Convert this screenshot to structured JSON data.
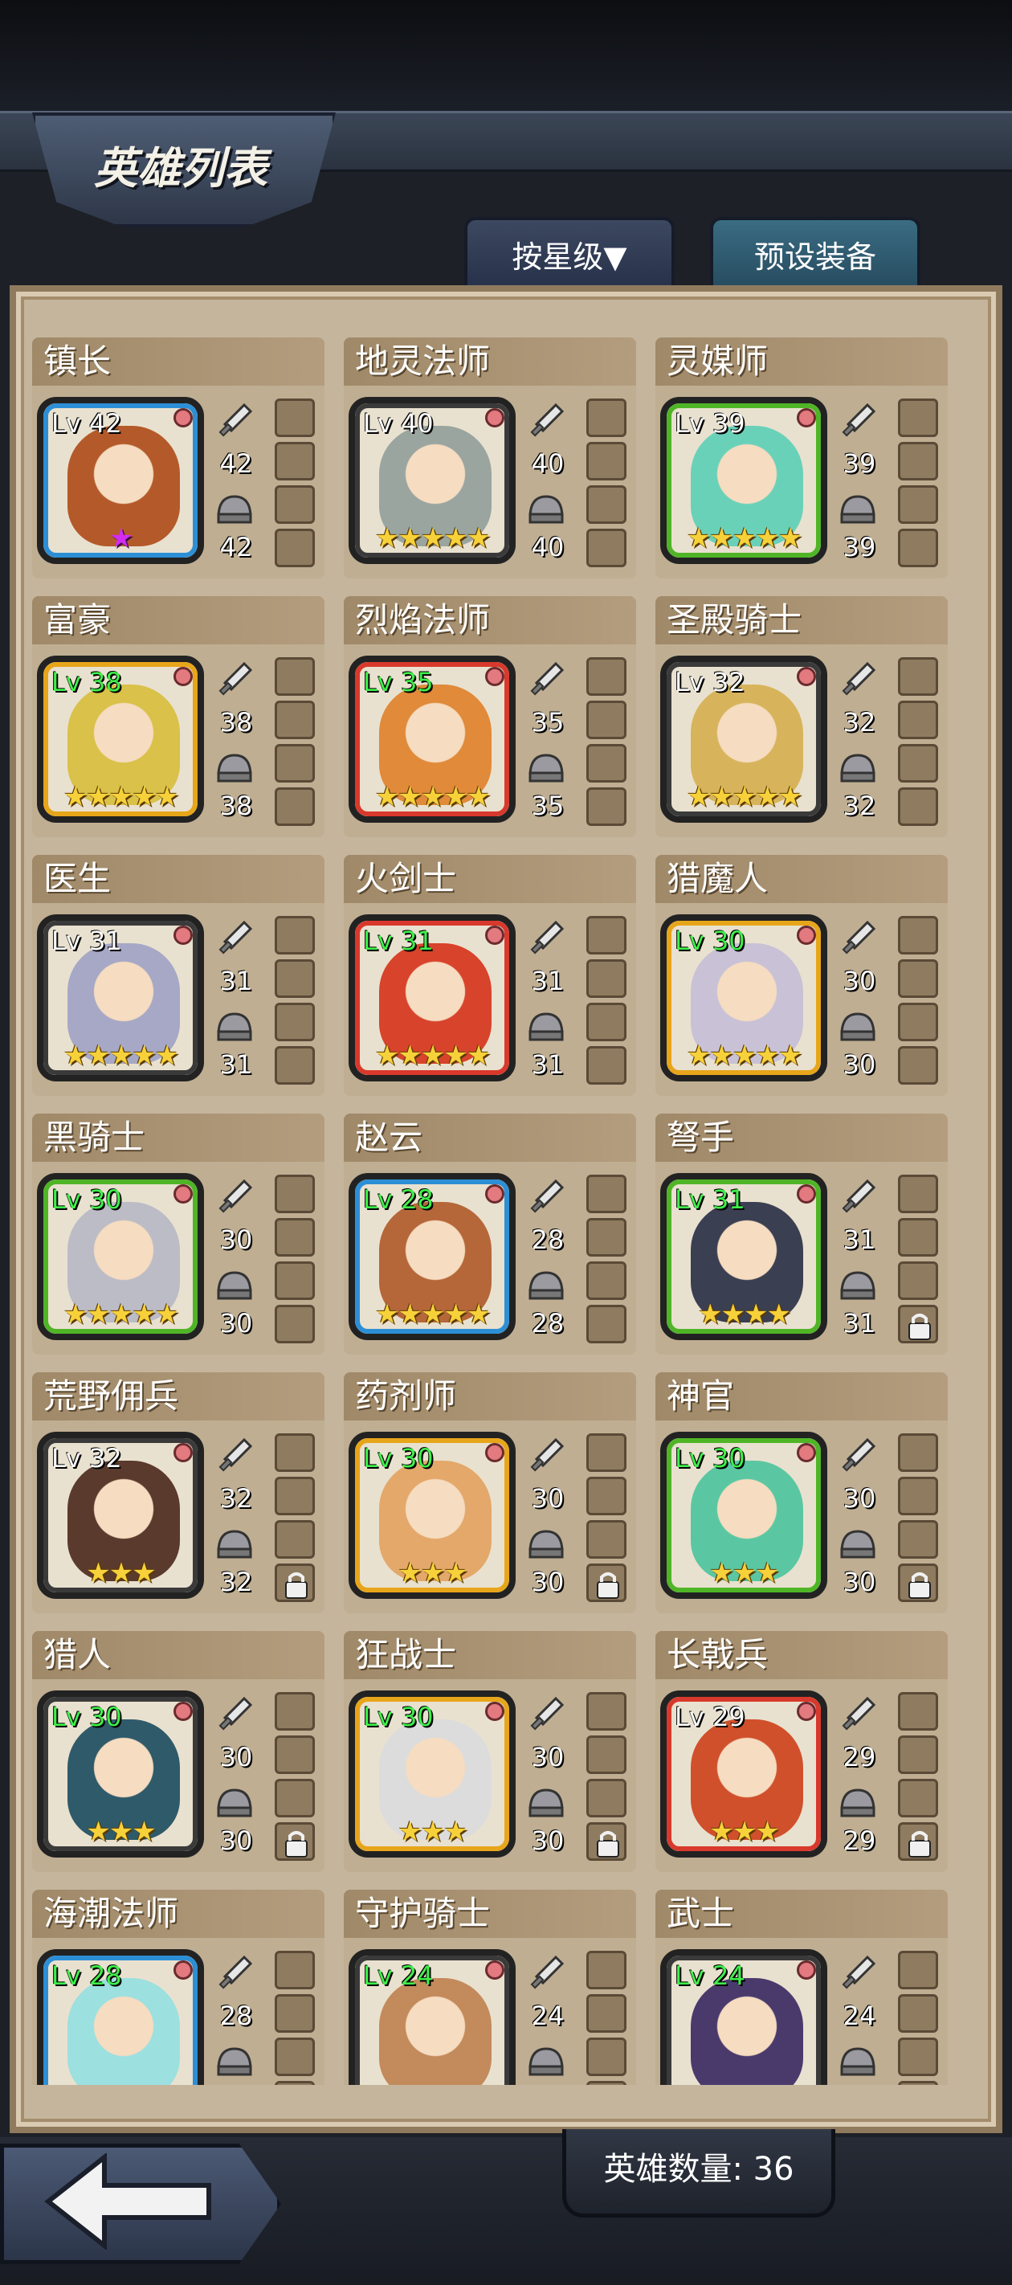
{
  "header": {
    "title": "英雄列表"
  },
  "tabs": {
    "sort_label": "按星级▼",
    "preset_label": "预设装备"
  },
  "footer": {
    "hero_count": "英雄数量: 36"
  },
  "colors": {
    "gold": "#f7d13a",
    "purple": "#d22cf0",
    "green_text": "#3ef04a"
  },
  "heroes": [
    {
      "name": "镇长",
      "level": "Lv 42",
      "lv_green": false,
      "frame": "blue",
      "stars": 1,
      "star_color": "purple",
      "weapon": "42",
      "armor": "42",
      "locked": false,
      "art": "#b45a2a"
    },
    {
      "name": "地灵法师",
      "level": "Lv 40",
      "lv_green": false,
      "frame": "dark",
      "stars": 5,
      "star_color": "gold",
      "weapon": "40",
      "armor": "40",
      "locked": false,
      "art": "#9aa5a0"
    },
    {
      "name": "灵媒师",
      "level": "Lv 39",
      "lv_green": false,
      "frame": "green",
      "stars": 5,
      "star_color": "gold",
      "weapon": "39",
      "armor": "39",
      "locked": false,
      "art": "#6ad1b9"
    },
    {
      "name": "富豪",
      "level": "Lv 38",
      "lv_green": true,
      "frame": "gold",
      "stars": 5,
      "star_color": "gold",
      "weapon": "38",
      "armor": "38",
      "locked": false,
      "art": "#d9c14a"
    },
    {
      "name": "烈焰法师",
      "level": "Lv 35",
      "lv_green": true,
      "frame": "red",
      "stars": 5,
      "star_color": "gold",
      "weapon": "35",
      "armor": "35",
      "locked": false,
      "art": "#e08a3a"
    },
    {
      "name": "圣殿骑士",
      "level": "Lv 32",
      "lv_green": false,
      "frame": "dark",
      "stars": 5,
      "star_color": "gold",
      "weapon": "32",
      "armor": "32",
      "locked": false,
      "art": "#d7b45c"
    },
    {
      "name": "医生",
      "level": "Lv 31",
      "lv_green": false,
      "frame": "dark",
      "stars": 5,
      "star_color": "gold",
      "weapon": "31",
      "armor": "31",
      "locked": false,
      "art": "#a6a8c6"
    },
    {
      "name": "火剑士",
      "level": "Lv 31",
      "lv_green": true,
      "frame": "red",
      "stars": 5,
      "star_color": "gold",
      "weapon": "31",
      "armor": "31",
      "locked": false,
      "art": "#d8432c"
    },
    {
      "name": "猎魔人",
      "level": "Lv 30",
      "lv_green": true,
      "frame": "gold",
      "stars": 5,
      "star_color": "gold",
      "weapon": "30",
      "armor": "30",
      "locked": false,
      "art": "#c9c2d6"
    },
    {
      "name": "黑骑士",
      "level": "Lv 30",
      "lv_green": true,
      "frame": "green",
      "stars": 5,
      "star_color": "gold",
      "weapon": "30",
      "armor": "30",
      "locked": false,
      "art": "#bcbcc6"
    },
    {
      "name": "赵云",
      "level": "Lv 28",
      "lv_green": true,
      "frame": "blue",
      "stars": 5,
      "star_color": "gold",
      "weapon": "28",
      "armor": "28",
      "locked": false,
      "art": "#b5673a"
    },
    {
      "name": "弩手",
      "level": "Lv 31",
      "lv_green": true,
      "frame": "green",
      "stars": 4,
      "star_color": "gold",
      "weapon": "31",
      "armor": "31",
      "locked": true,
      "art": "#3b3f52"
    },
    {
      "name": "荒野佣兵",
      "level": "Lv 32",
      "lv_green": false,
      "frame": "dark",
      "stars": 3,
      "star_color": "gold",
      "weapon": "32",
      "armor": "32",
      "locked": true,
      "art": "#5a3a2c"
    },
    {
      "name": "药剂师",
      "level": "Lv 30",
      "lv_green": true,
      "frame": "gold",
      "stars": 3,
      "star_color": "gold",
      "weapon": "30",
      "armor": "30",
      "locked": true,
      "art": "#e3a86a"
    },
    {
      "name": "神官",
      "level": "Lv 30",
      "lv_green": true,
      "frame": "green",
      "stars": 3,
      "star_color": "gold",
      "weapon": "30",
      "armor": "30",
      "locked": true,
      "art": "#5ac7a2"
    },
    {
      "name": "猎人",
      "level": "Lv 30",
      "lv_green": true,
      "frame": "dark",
      "stars": 3,
      "star_color": "gold",
      "weapon": "30",
      "armor": "30",
      "locked": true,
      "art": "#2f5a6a"
    },
    {
      "name": "狂战士",
      "level": "Lv 30",
      "lv_green": true,
      "frame": "gold",
      "stars": 3,
      "star_color": "gold",
      "weapon": "30",
      "armor": "30",
      "locked": true,
      "art": "#dcdcdc"
    },
    {
      "name": "长戟兵",
      "level": "Lv 29",
      "lv_green": false,
      "frame": "red",
      "stars": 3,
      "star_color": "gold",
      "weapon": "29",
      "armor": "29",
      "locked": true,
      "art": "#d0502c"
    },
    {
      "name": "海潮法师",
      "level": "Lv 28",
      "lv_green": true,
      "frame": "blue",
      "stars": 0,
      "star_color": "gold",
      "weapon": "28",
      "armor": "",
      "locked": false,
      "art": "#9ce0e0"
    },
    {
      "name": "守护骑士",
      "level": "Lv 24",
      "lv_green": true,
      "frame": "dark",
      "stars": 0,
      "star_color": "gold",
      "weapon": "24",
      "armor": "",
      "locked": false,
      "art": "#c38a5c"
    },
    {
      "name": "武士",
      "level": "Lv 24",
      "lv_green": true,
      "frame": "dark",
      "stars": 0,
      "star_color": "gold",
      "weapon": "24",
      "armor": "",
      "locked": false,
      "art": "#4a3a6c"
    }
  ]
}
